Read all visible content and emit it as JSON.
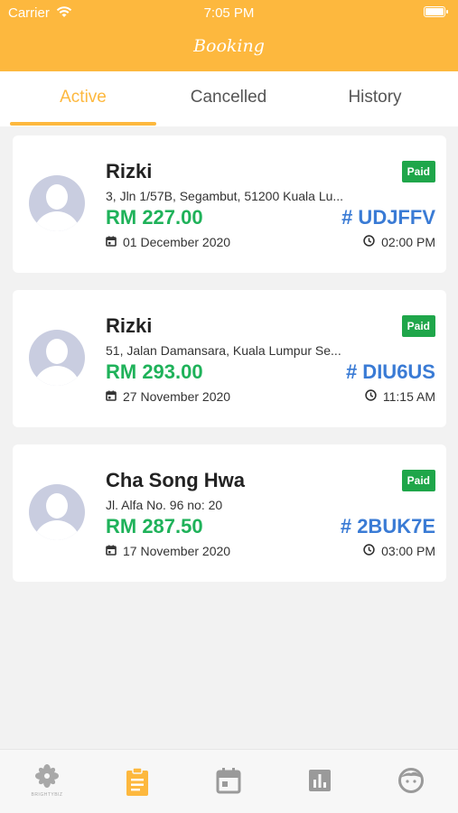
{
  "status_bar": {
    "carrier": "Carrier",
    "time": "7:05 PM"
  },
  "header": {
    "title": "Booking"
  },
  "tabs": [
    {
      "label": "Active",
      "active": true
    },
    {
      "label": "Cancelled",
      "active": false
    },
    {
      "label": "History",
      "active": false
    }
  ],
  "bookings": [
    {
      "name": "Rizki",
      "status": "Paid",
      "address": "3, Jln 1/57B, Segambut, 51200 Kuala Lu...",
      "price": "RM 227.00",
      "code": "# UDJFFV",
      "date": "01 December 2020",
      "time": "02:00 PM"
    },
    {
      "name": "Rizki",
      "status": "Paid",
      "address": "51, Jalan Damansara, Kuala Lumpur Se...",
      "price": "RM 293.00",
      "code": "# DIU6US",
      "date": "27 November 2020",
      "time": "11:15 AM"
    },
    {
      "name": "Cha Song Hwa",
      "status": "Paid",
      "address": "Jl. Alfa No. 96 no: 20",
      "price": "RM 287.50",
      "code": "# 2BUK7E",
      "date": "17 November 2020",
      "time": "03:00 PM"
    }
  ],
  "bottom_nav": [
    {
      "icon": "flower-logo-icon",
      "caption": "BRIGHTYBIZ",
      "active": false
    },
    {
      "icon": "clipboard-icon",
      "active": true
    },
    {
      "icon": "calendar-icon",
      "active": false
    },
    {
      "icon": "bar-chart-icon",
      "active": false
    },
    {
      "icon": "profile-face-icon",
      "active": false
    }
  ],
  "colors": {
    "accent": "#fdb83e",
    "price": "#1fb25a",
    "code": "#3a7bd5",
    "paid": "#1fa64a",
    "inactive_icon": "#9a9a9a"
  }
}
